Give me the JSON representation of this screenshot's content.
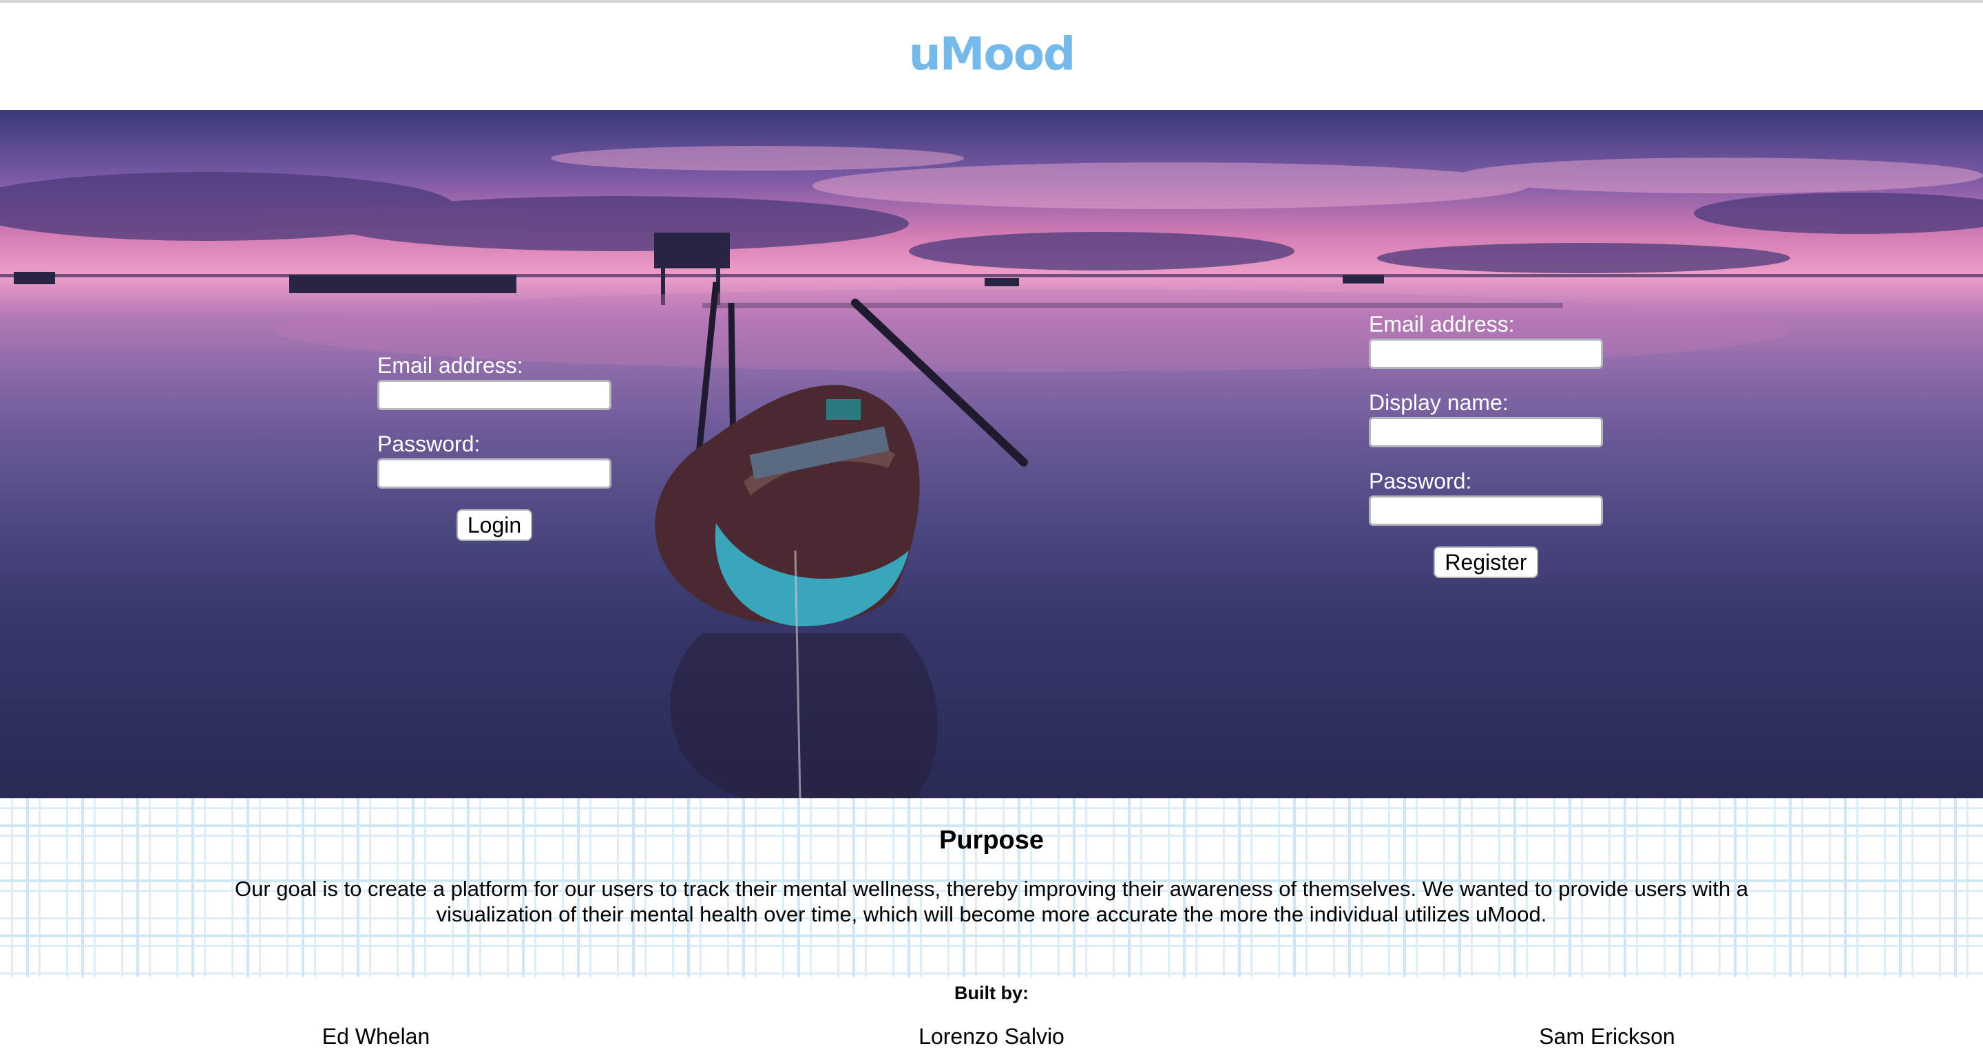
{
  "app": {
    "logo": "uMood",
    "brand_color": "#74b9ea"
  },
  "login_form": {
    "email_label": "Email address:",
    "email_value": "",
    "password_label": "Password:",
    "password_value": "",
    "submit_label": "Login"
  },
  "register_form": {
    "email_label": "Email address:",
    "email_value": "",
    "display_name_label": "Display name:",
    "display_name_value": "",
    "password_label": "Password:",
    "password_value": "",
    "submit_label": "Register"
  },
  "purpose": {
    "title": "Purpose",
    "text": "Our goal is to create a platform for our users to track their mental wellness, thereby improving their awareness of themselves. We wanted to provide users with a visualization of their mental health over time, which will become more accurate the more the individual utilizes uMood."
  },
  "footer": {
    "built_by_label": "Built by:",
    "authors": [
      "Ed Whelan",
      "Lorenzo Salvio",
      "Sam Erickson"
    ]
  }
}
